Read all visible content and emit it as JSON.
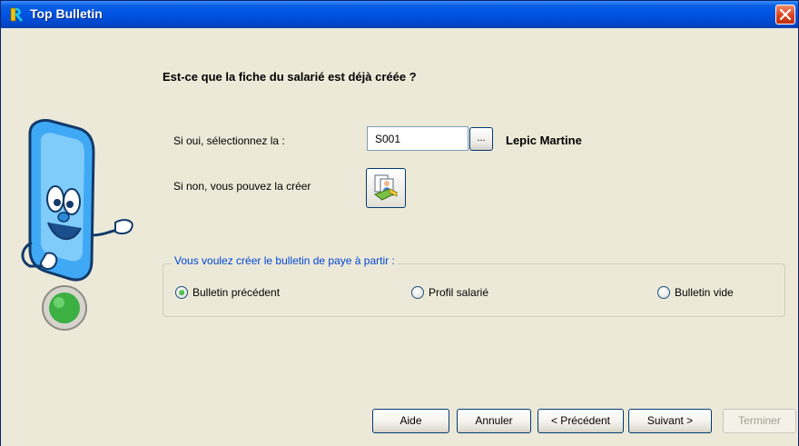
{
  "window": {
    "title": "Top Bulletin",
    "icon": "app-logo-icon",
    "close_icon": "close-icon"
  },
  "question": "Est-ce que la fiche du salarié est déjà créée ?",
  "existing": {
    "label": "Si oui, sélectionnez la :",
    "code_value": "S001",
    "browse_label": "...",
    "employee_name": "Lepic Martine"
  },
  "create": {
    "label": "Si non, vous pouvez la créer",
    "icon": "create-employee-icon"
  },
  "bulletin_group": {
    "legend": "Vous voulez créer le bulletin de paye à partir :",
    "options": [
      {
        "label": "Bulletin précédent",
        "selected": true
      },
      {
        "label": "Profil salarié",
        "selected": false
      },
      {
        "label": "Bulletin vide",
        "selected": false
      }
    ]
  },
  "buttons": {
    "aide": "Aide",
    "annuler": "Annuler",
    "precedent": "< Précédent",
    "suivant": "Suivant >",
    "terminer": "Terminer"
  },
  "colors": {
    "titlebar": "#0054E3",
    "dialog_bg": "#ECE9D8",
    "group_legend": "#0046D5",
    "close_button": "#D9431E",
    "mascot_blue": "#3FA9F5",
    "status_light": "#3CB043"
  }
}
